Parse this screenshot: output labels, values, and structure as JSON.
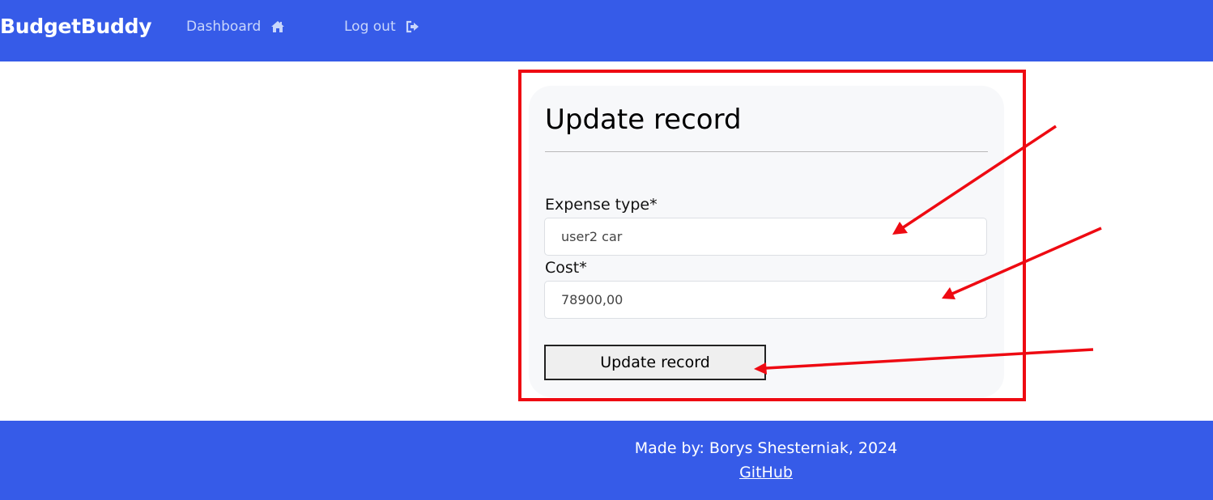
{
  "navbar": {
    "brand": "BudgetBuddy",
    "links": [
      {
        "label": "Dashboard",
        "icon": "home-icon"
      },
      {
        "label": "Log out",
        "icon": "sign-out-icon"
      }
    ],
    "bg_color": "#365be8"
  },
  "form": {
    "title": "Update record",
    "fields": [
      {
        "label": "Expense type*",
        "value": "user2 car"
      },
      {
        "label": "Cost*",
        "value": "78900,00"
      }
    ],
    "submit_label": "Update record"
  },
  "annotations": {
    "color": "#ee0a12"
  },
  "footer": {
    "credit": "Made by: Borys Shesterniak, 2024",
    "link_label": "GitHub"
  }
}
